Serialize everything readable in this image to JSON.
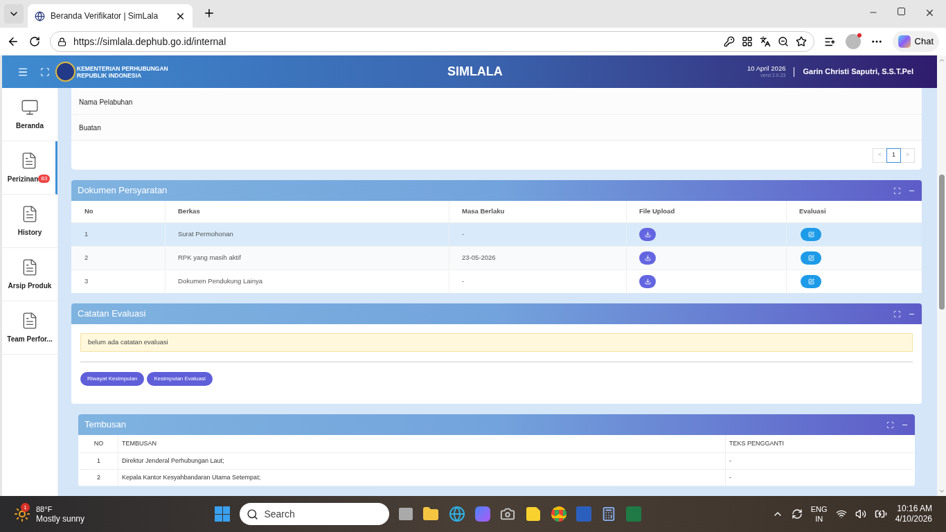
{
  "browser": {
    "tab_title": "Beranda Verifikator | SimLala",
    "url": "https://simlala.dephub.go.id/internal",
    "chat_label": "Chat"
  },
  "header": {
    "org_line1": "KEMENTERIAN PERHUBUNGAN",
    "org_line2": "REPUBLIK INDONESIA",
    "app_title": "SIMLALA",
    "date": "10 April 2026",
    "version": "versi 2.0.23",
    "user": "Garin Christi Saputri, S.S.T.Pel"
  },
  "sidebar": {
    "items": [
      {
        "label": "Beranda",
        "kind": "monitor",
        "selected": false
      },
      {
        "label": "Perizinan",
        "kind": "document",
        "badge": "83",
        "selected": true
      },
      {
        "label": "History",
        "kind": "document",
        "selected": false
      },
      {
        "label": "Arsip Produk",
        "kind": "document",
        "selected": false
      },
      {
        "label": "Team Perfor...",
        "kind": "document",
        "selected": false
      }
    ]
  },
  "info_card": {
    "rows": [
      "Nama Pelabuhan",
      "Buatan"
    ],
    "pagination": [
      {
        "label": "<",
        "selected": false
      },
      {
        "label": "1",
        "selected": true
      },
      {
        "label": ">",
        "selected": false
      }
    ]
  },
  "dokumen": {
    "title": "Dokumen Persyaratan",
    "columns": [
      "No",
      "Berkas",
      "Masa Berlaku",
      "File Upload",
      "Evaluasi"
    ],
    "rows": [
      {
        "no": "1",
        "berkas": "Surat Permohonan",
        "masa_berlaku": "-",
        "highlighted": true
      },
      {
        "no": "2",
        "berkas": "RPK yang masih aktif",
        "masa_berlaku": "23-05-2026",
        "highlighted": false
      },
      {
        "no": "3",
        "berkas": "Dokumen Pendukung Lainya",
        "masa_berlaku": "-",
        "highlighted": false
      }
    ]
  },
  "catatan": {
    "title": "Catatan Evaluasi",
    "note": "belum ada catatan evaluasi",
    "buttons": [
      "Riwayat Kesimpulan",
      "Kesimpulan Evaluasi"
    ]
  },
  "tembusan": {
    "title": "Tembusan",
    "columns": [
      "NO",
      "TEMBUSAN",
      "TEKS PENGGANTI"
    ],
    "rows": [
      {
        "no": "1",
        "tembusan": "Direktur Jenderal Perhubungan Laut;",
        "teks": "-"
      },
      {
        "no": "2",
        "tembusan": "Kepala Kantor Kesyahbandaran Utama Setempat;",
        "teks": "-"
      }
    ]
  },
  "taskbar": {
    "weather_badge": "1",
    "temperature": "88°F",
    "weather": "Mostly sunny",
    "search_placeholder": "Search",
    "language": "ENG",
    "region": "IN",
    "time": "10:16 AM",
    "date": "4/10/2026"
  }
}
